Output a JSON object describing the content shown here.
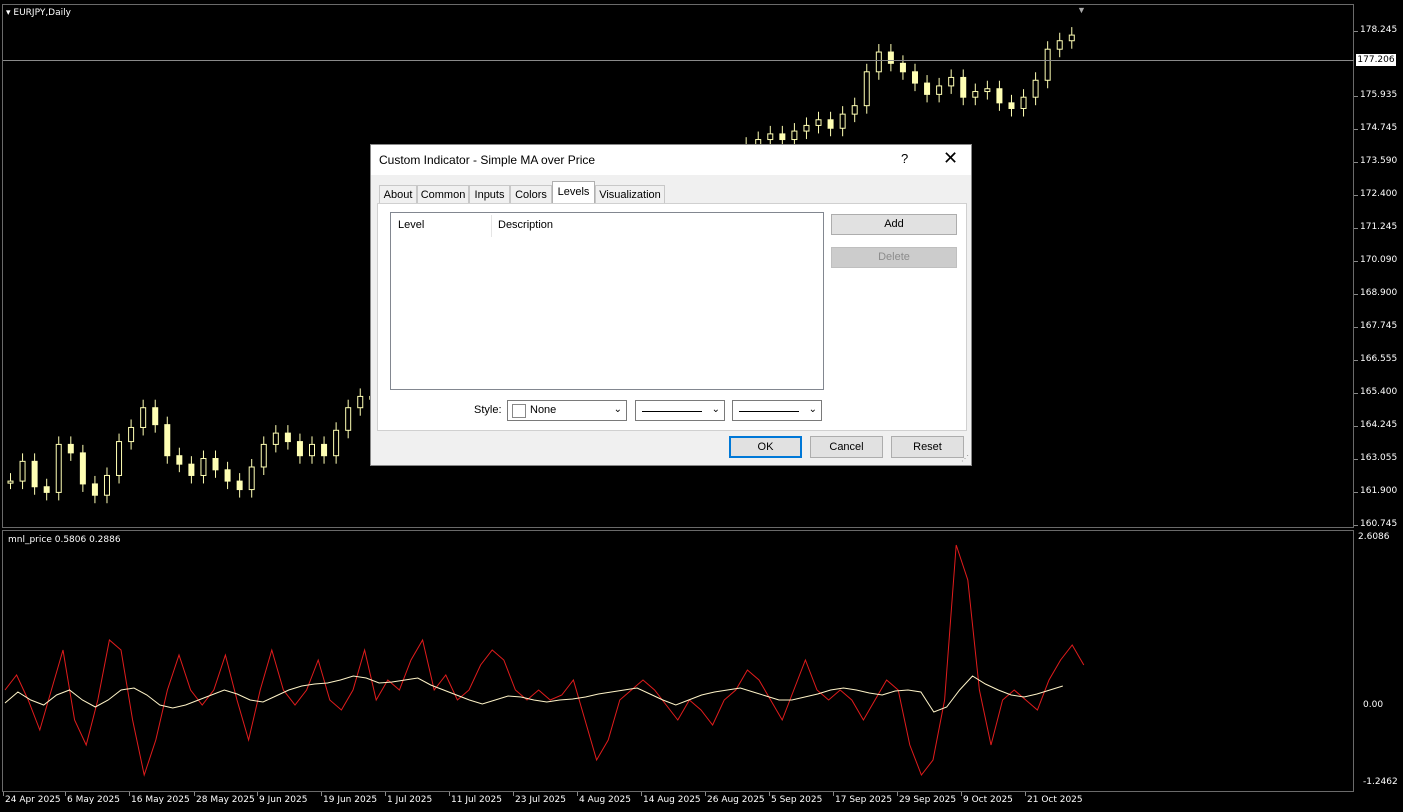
{
  "chart": {
    "symbol_title": "EURJPY,Daily",
    "current_price": "177.206",
    "price_axis": [
      "178.245",
      "177.206",
      "175.935",
      "174.745",
      "173.590",
      "172.400",
      "171.245",
      "170.090",
      "168.900",
      "167.745",
      "166.555",
      "165.400",
      "164.245",
      "163.055",
      "161.900",
      "160.745"
    ],
    "indicator_title": "mnl_price 0.5806 0.2886",
    "indicator_axis": [
      "2.6086",
      "0.00",
      "-1.2462"
    ],
    "date_axis": [
      "24 Apr 2025",
      "6 May 2025",
      "16 May 2025",
      "28 May 2025",
      "9 Jun 2025",
      "19 Jun 2025",
      "1 Jul 2025",
      "11 Jul 2025",
      "23 Jul 2025",
      "4 Aug 2025",
      "14 Aug 2025",
      "26 Aug 2025",
      "5 Sep 2025",
      "17 Sep 2025",
      "29 Sep 2025",
      "9 Oct 2025",
      "21 Oct 2025"
    ],
    "colors": {
      "candle": "#ffffb4",
      "osc_line": "#e01c1c",
      "signal_line": "#fff4c8",
      "grid": "#6a6a6a"
    }
  },
  "dialog": {
    "title": "Custom Indicator - Simple MA over Price",
    "help_label": "?",
    "close_label": "✕",
    "tabs": [
      "About",
      "Common",
      "Inputs",
      "Colors",
      "Levels",
      "Visualization"
    ],
    "active_tab": "Levels",
    "levels_table": {
      "columns": [
        "Level",
        "Description"
      ],
      "rows": []
    },
    "add_label": "Add",
    "delete_label": "Delete",
    "style_label": "Style:",
    "style_color_value": "None",
    "ok_label": "OK",
    "cancel_label": "Cancel",
    "reset_label": "Reset"
  }
}
